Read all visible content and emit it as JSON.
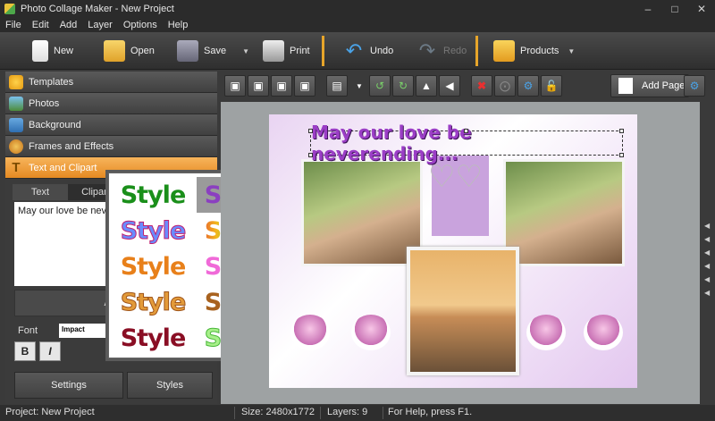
{
  "window": {
    "title": "Photo Collage Maker - New Project"
  },
  "menu": [
    "File",
    "Edit",
    "Add",
    "Layer",
    "Options",
    "Help"
  ],
  "toolbar": {
    "new": "New",
    "open": "Open",
    "save": "Save",
    "print": "Print",
    "undo": "Undo",
    "redo": "Redo",
    "products": "Products"
  },
  "sidebar": {
    "sections": [
      {
        "label": "Templates"
      },
      {
        "label": "Photos"
      },
      {
        "label": "Background"
      },
      {
        "label": "Frames and Effects"
      },
      {
        "label": "Text and Clipart"
      }
    ],
    "tabs": {
      "text": "Text",
      "clipart": "Clipart"
    },
    "text_value": "May our love be never",
    "add_label": "Add",
    "font_label": "Font",
    "font_value": "Impact",
    "bold": "B",
    "italic": "I",
    "settings": "Settings",
    "styles": "Styles"
  },
  "style_popup": {
    "items": [
      {
        "label": "Style"
      },
      {
        "label": "Style"
      },
      {
        "label": "Style"
      },
      {
        "label": "Style"
      },
      {
        "label": "Style"
      },
      {
        "label": "Style"
      },
      {
        "label": "Style"
      },
      {
        "label": "Style"
      },
      {
        "label": "Style"
      },
      {
        "label": "Style"
      }
    ]
  },
  "page_toolbar": {
    "add_page": "Add Page"
  },
  "canvas": {
    "heading": "May our love be neverending..."
  },
  "status": {
    "project": "Project: New Project",
    "size": "Size: 2480x1772",
    "layers": "Layers: 9",
    "help": "For Help, press F1."
  },
  "colors": {
    "accent": "#e58a22",
    "heading": "#9b3ec6"
  }
}
